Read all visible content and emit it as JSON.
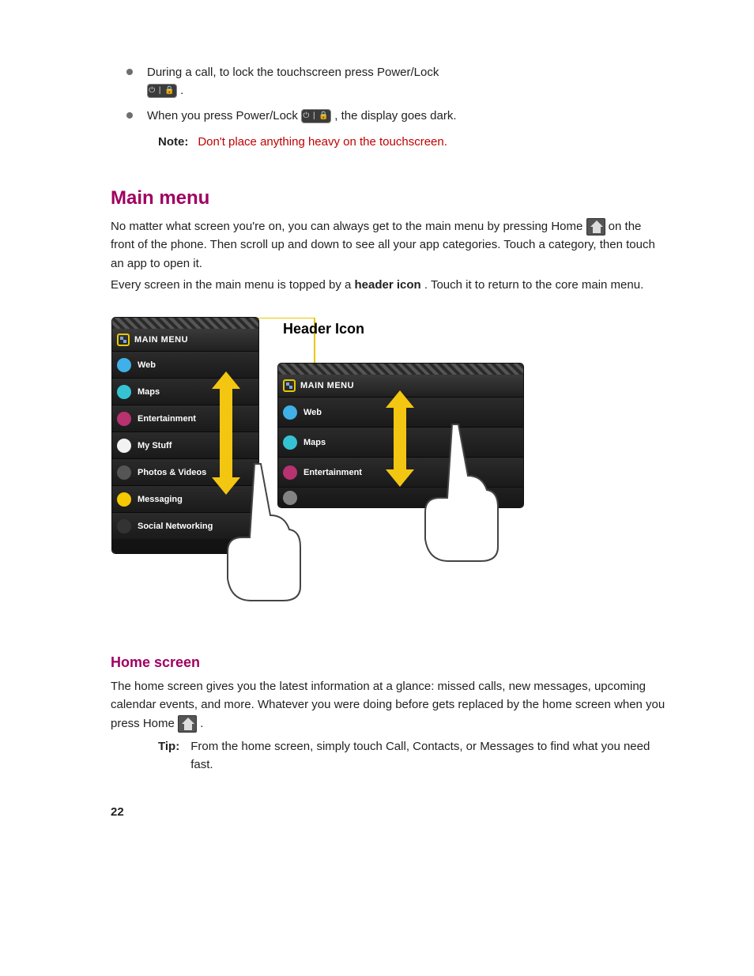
{
  "bullets": {
    "b1_pre": "During a call, to lock the touchscreen press Power/Lock",
    "b1_post": ".",
    "b2_pre": "When you press Power/Lock ",
    "b2_post": ", the display goes dark."
  },
  "note": {
    "label": "Note:",
    "text": "Don't place anything heavy on the touchscreen."
  },
  "mainMenu": {
    "heading": "Main menu",
    "p1_pre": "No matter what screen you're on, you can always get to the main menu by pressing Home ",
    "p1_post": " on the front of the phone. Then scroll up and down to see all your app categories. Touch a category, then touch an app to open it.",
    "p2_pre": "Every screen in the main menu is topped by a ",
    "p2_bold": "header icon",
    "p2_post": ". Touch it to return to the core main menu."
  },
  "illus": {
    "callout": "Header Icon",
    "header": "MAIN MENU",
    "itemsLong": [
      "Web",
      "Maps",
      "Entertainment",
      "My Stuff",
      "Photos & Videos",
      "Messaging",
      "Social Networking"
    ],
    "itemsShort": [
      "Web",
      "Maps",
      "Entertainment"
    ]
  },
  "homeScreen": {
    "heading": "Home screen",
    "p1_pre": "The home screen gives you the latest information at a glance: missed calls, new messages, upcoming calendar events, and more. Whatever you were doing before gets replaced by the home screen when you press Home ",
    "p1_post": "."
  },
  "tip": {
    "label": "Tip:",
    "text": "From the home screen, simply touch Call, Contacts, or Messages to find what you need fast."
  },
  "pageNum": "22"
}
